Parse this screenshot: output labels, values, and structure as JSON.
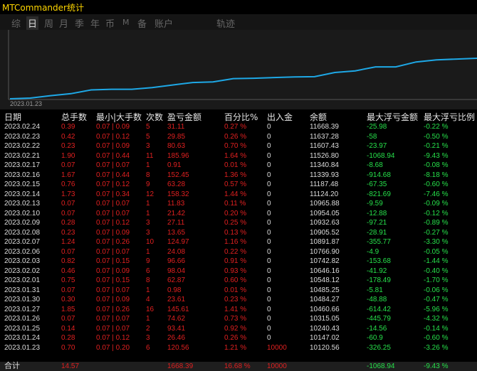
{
  "window": {
    "title": "MTCommander统计"
  },
  "tabs": [
    {
      "label": "综",
      "active": false
    },
    {
      "label": "日",
      "active": true
    },
    {
      "label": "周",
      "active": false
    },
    {
      "label": "月",
      "active": false
    },
    {
      "label": "季",
      "active": false
    },
    {
      "label": "年",
      "active": false
    },
    {
      "label": "币",
      "active": false
    },
    {
      "label": "M",
      "active": false
    },
    {
      "label": "备",
      "active": false
    },
    {
      "label": "账户",
      "active": false
    },
    {
      "label": "轨迹",
      "active": false
    }
  ],
  "chart_data": {
    "type": "line",
    "x_start_label": "2023.01.23",
    "x": [
      "2023.01.23",
      "2023.01.24",
      "2023.01.25",
      "2023.01.26",
      "2023.01.27",
      "2023.01.30",
      "2023.01.31",
      "2023.02.01",
      "2023.02.02",
      "2023.02.03",
      "2023.02.06",
      "2023.02.07",
      "2023.02.08",
      "2023.02.09",
      "2023.02.10",
      "2023.02.13",
      "2023.02.14",
      "2023.02.15",
      "2023.02.16",
      "2023.02.17",
      "2023.02.21",
      "2023.02.22",
      "2023.02.23",
      "2023.02.24"
    ],
    "series": [
      {
        "values": [
          10120.56,
          10147.02,
          10240.43,
          10315.05,
          10460.66,
          10484.27,
          10485.25,
          10548.12,
          10646.16,
          10742.82,
          10766.9,
          10891.87,
          10905.52,
          10932.63,
          10954.05,
          10965.88,
          11124.2,
          11187.48,
          11339.93,
          11340.84,
          11526.8,
          11607.43,
          11637.28,
          11668.39
        ],
        "color": "#1ea8e6"
      }
    ],
    "grid": false
  },
  "table": {
    "headers": [
      "日期",
      "总手数",
      "最小|大手数",
      "次数",
      "盈亏金额",
      "百分比%",
      "出入金",
      "余额",
      "最大浮亏金额",
      "最大浮亏比例"
    ],
    "rows": [
      [
        "2023.02.24",
        "0.39",
        "0.07 | 0.09",
        "5",
        "31.11",
        "0.27 %",
        "0",
        "11668.39",
        "-25.98",
        "-0.22 %"
      ],
      [
        "2023.02.23",
        "0.42",
        "0.07 | 0.12",
        "5",
        "29.85",
        "0.26 %",
        "0",
        "11637.28",
        "-58",
        "-0.50 %"
      ],
      [
        "2023.02.22",
        "0.23",
        "0.07 | 0.09",
        "3",
        "80.63",
        "0.70 %",
        "0",
        "11607.43",
        "-23.97",
        "-0.21 %"
      ],
      [
        "2023.02.21",
        "1.90",
        "0.07 | 0.44",
        "11",
        "185.96",
        "1.64 %",
        "0",
        "11526.80",
        "-1068.94",
        "-9.43 %"
      ],
      [
        "2023.02.17",
        "0.07",
        "0.07 | 0.07",
        "1",
        "0.91",
        "0.01 %",
        "0",
        "11340.84",
        "-8.68",
        "-0.08 %"
      ],
      [
        "2023.02.16",
        "1.67",
        "0.07 | 0.44",
        "8",
        "152.45",
        "1.36 %",
        "0",
        "11339.93",
        "-914.68",
        "-8.18 %"
      ],
      [
        "2023.02.15",
        "0.76",
        "0.07 | 0.12",
        "9",
        "63.28",
        "0.57 %",
        "0",
        "11187.48",
        "-67.35",
        "-0.60 %"
      ],
      [
        "2023.02.14",
        "1.73",
        "0.07 | 0.34",
        "12",
        "158.32",
        "1.44 %",
        "0",
        "11124.20",
        "-821.69",
        "-7.46 %"
      ],
      [
        "2023.02.13",
        "0.07",
        "0.07 | 0.07",
        "1",
        "11.83",
        "0.11 %",
        "0",
        "10965.88",
        "-9.59",
        "-0.09 %"
      ],
      [
        "2023.02.10",
        "0.07",
        "0.07 | 0.07",
        "1",
        "21.42",
        "0.20 %",
        "0",
        "10954.05",
        "-12.88",
        "-0.12 %"
      ],
      [
        "2023.02.09",
        "0.28",
        "0.07 | 0.12",
        "3",
        "27.11",
        "0.25 %",
        "0",
        "10932.63",
        "-97.21",
        "-0.89 %"
      ],
      [
        "2023.02.08",
        "0.23",
        "0.07 | 0.09",
        "3",
        "13.65",
        "0.13 %",
        "0",
        "10905.52",
        "-28.91",
        "-0.27 %"
      ],
      [
        "2023.02.07",
        "1.24",
        "0.07 | 0.26",
        "10",
        "124.97",
        "1.16 %",
        "0",
        "10891.87",
        "-355.77",
        "-3.30 %"
      ],
      [
        "2023.02.06",
        "0.07",
        "0.07 | 0.07",
        "1",
        "24.08",
        "0.22 %",
        "0",
        "10766.90",
        "-4.9",
        "-0.05 %"
      ],
      [
        "2023.02.03",
        "0.82",
        "0.07 | 0.15",
        "9",
        "96.66",
        "0.91 %",
        "0",
        "10742.82",
        "-153.68",
        "-1.44 %"
      ],
      [
        "2023.02.02",
        "0.46",
        "0.07 | 0.09",
        "6",
        "98.04",
        "0.93 %",
        "0",
        "10646.16",
        "-41.92",
        "-0.40 %"
      ],
      [
        "2023.02.01",
        "0.75",
        "0.07 | 0.15",
        "8",
        "62.87",
        "0.60 %",
        "0",
        "10548.12",
        "-178.49",
        "-1.70 %"
      ],
      [
        "2023.01.31",
        "0.07",
        "0.07 | 0.07",
        "1",
        "0.98",
        "0.01 %",
        "0",
        "10485.25",
        "-5.81",
        "-0.06 %"
      ],
      [
        "2023.01.30",
        "0.30",
        "0.07 | 0.09",
        "4",
        "23.61",
        "0.23 %",
        "0",
        "10484.27",
        "-48.88",
        "-0.47 %"
      ],
      [
        "2023.01.27",
        "1.85",
        "0.07 | 0.26",
        "16",
        "145.61",
        "1.41 %",
        "0",
        "10460.66",
        "-614.42",
        "-5.96 %"
      ],
      [
        "2023.01.26",
        "0.07",
        "0.07 | 0.07",
        "1",
        "74.62",
        "0.73 %",
        "0",
        "10315.05",
        "-445.79",
        "-4.32 %"
      ],
      [
        "2023.01.25",
        "0.14",
        "0.07 | 0.07",
        "2",
        "93.41",
        "0.92 %",
        "0",
        "10240.43",
        "-14.56",
        "-0.14 %"
      ],
      [
        "2023.01.24",
        "0.28",
        "0.07 | 0.12",
        "3",
        "26.46",
        "0.26 %",
        "0",
        "10147.02",
        "-60.9",
        "-0.60 %"
      ],
      [
        "2023.01.23",
        "0.70",
        "0.07 | 0.20",
        "6",
        "120.56",
        "1.21 %",
        "10000",
        "10120.56",
        "-326.25",
        "-3.26 %"
      ]
    ],
    "total": {
      "label": "合计",
      "lots": "14.57",
      "pnl": "1668.39",
      "percent": "16.68 %",
      "deposit": "10000",
      "max_dd": "-1068.94",
      "max_dd_pct": "-9.43 %"
    }
  },
  "colors": {
    "profit": "#e02020",
    "drawdown": "#26e04a",
    "neutral": "#dddddd",
    "title": "#ffd700",
    "line": "#1ea8e6"
  }
}
